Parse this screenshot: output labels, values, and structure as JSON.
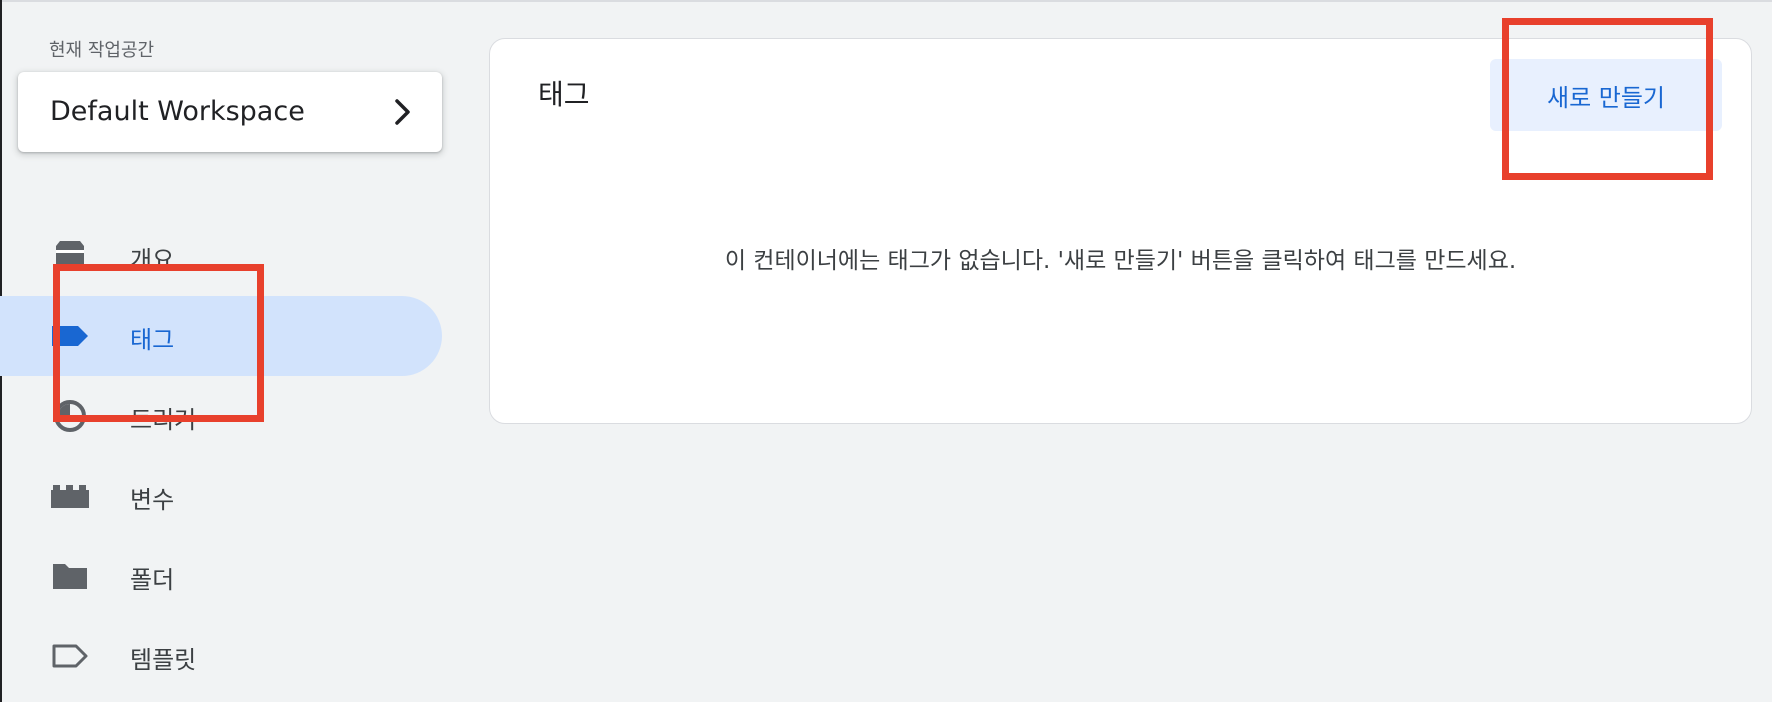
{
  "sidebar": {
    "workspace_label": "현재 작업공간",
    "workspace_name": "Default Workspace",
    "items": [
      {
        "id": "overview",
        "label": "개요",
        "icon": "overview-icon"
      },
      {
        "id": "tags",
        "label": "태그",
        "icon": "tag-icon",
        "active": true
      },
      {
        "id": "triggers",
        "label": "트리거",
        "icon": "trigger-icon"
      },
      {
        "id": "variables",
        "label": "변수",
        "icon": "variables-icon"
      },
      {
        "id": "folders",
        "label": "폴더",
        "icon": "folder-icon"
      },
      {
        "id": "templates",
        "label": "템플릿",
        "icon": "template-icon"
      }
    ]
  },
  "main": {
    "title": "태그",
    "new_button_label": "새로 만들기",
    "empty_message": "이 컨테이너에는 태그가 없습니다. '새로 만들기' 버튼을 클릭하여 태그를 만드세요."
  },
  "colors": {
    "accent": "#1967d2",
    "active_bg": "#d2e3fc",
    "highlight": "#e8402c",
    "background": "#f1f3f4"
  }
}
